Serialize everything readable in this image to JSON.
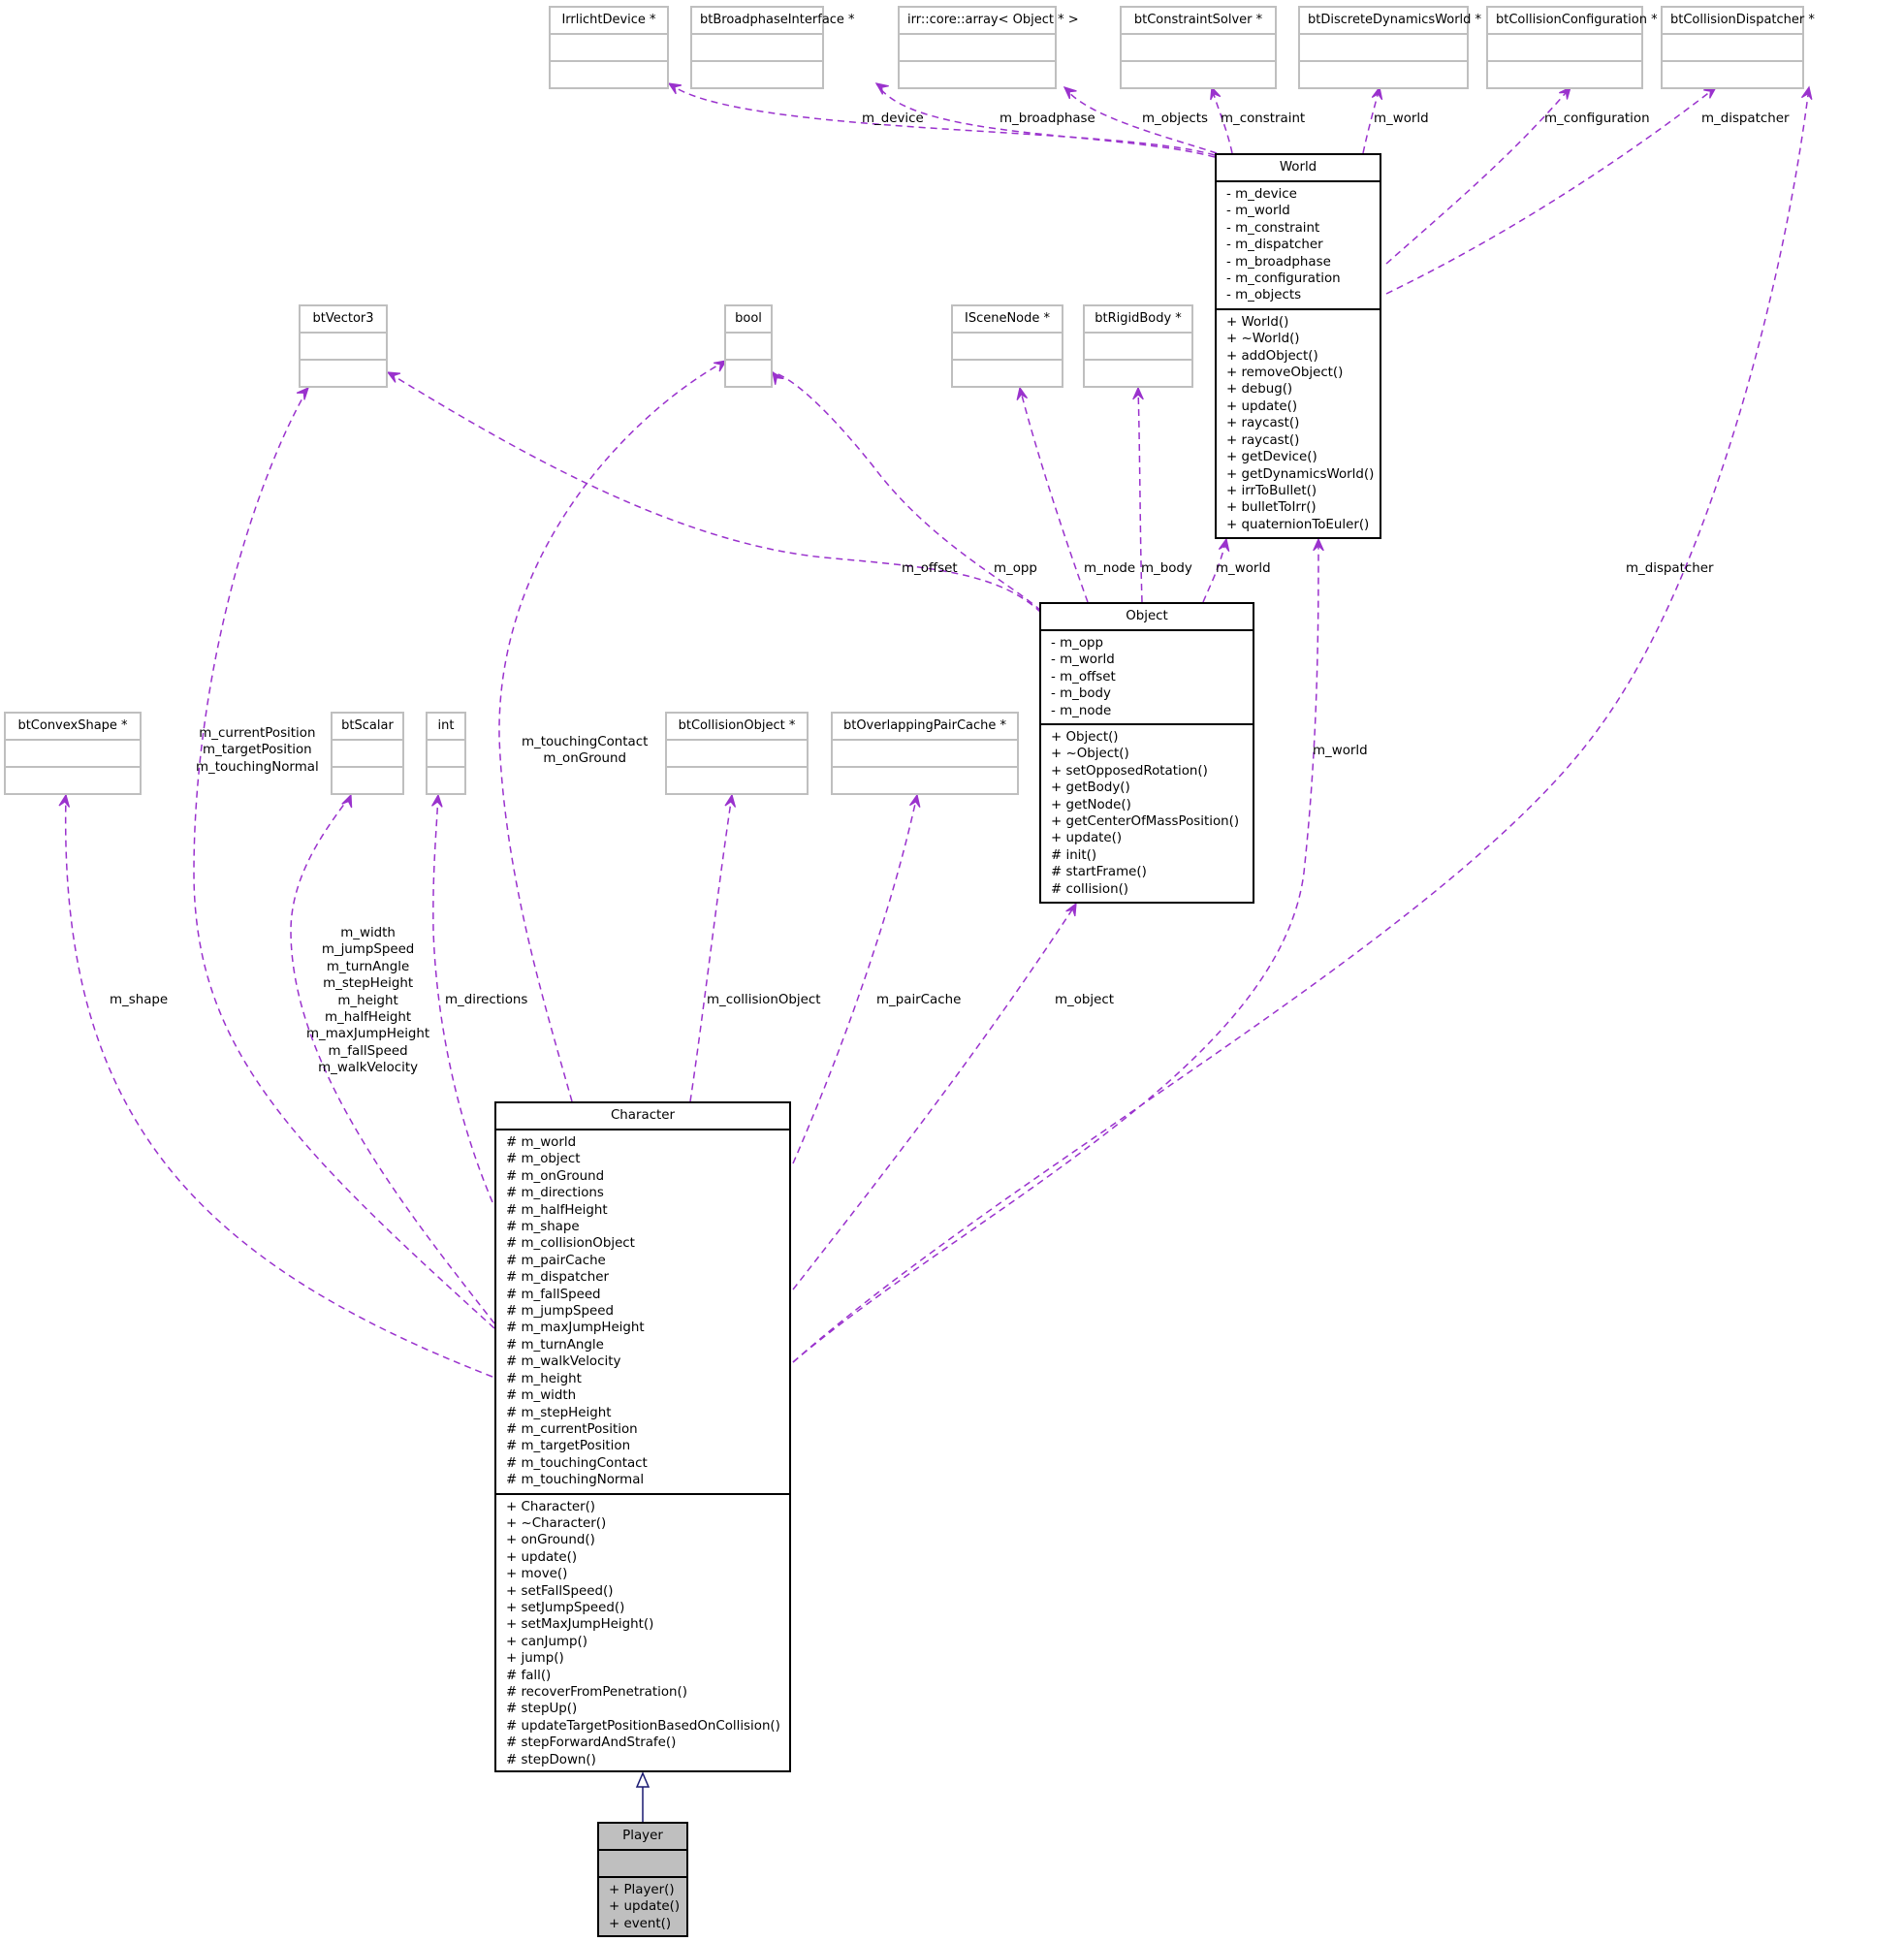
{
  "diagram": {
    "type": "uml-collaboration-diagram",
    "edge_color": "#9a32cd",
    "inheritance_color": "#191970",
    "highlight_fill": "#bfbfbf",
    "classes": {
      "player": {
        "name": "Player",
        "attributes": [],
        "operations": [
          "+ Player()",
          "+ update()",
          "+ event()"
        ]
      },
      "character": {
        "name": "Character",
        "attributes": [
          "# m_world",
          "# m_object",
          "# m_onGround",
          "# m_directions",
          "# m_halfHeight",
          "# m_shape",
          "# m_collisionObject",
          "# m_pairCache",
          "# m_dispatcher",
          "# m_fallSpeed",
          "# m_jumpSpeed",
          "# m_maxJumpHeight",
          "# m_turnAngle",
          "# m_walkVelocity",
          "# m_height",
          "# m_width",
          "# m_stepHeight",
          "# m_currentPosition",
          "# m_targetPosition",
          "# m_touchingContact",
          "# m_touchingNormal"
        ],
        "operations": [
          "+ Character()",
          "+ ~Character()",
          "+ onGround()",
          "+ update()",
          "+ move()",
          "+ setFallSpeed()",
          "+ setJumpSpeed()",
          "+ setMaxJumpHeight()",
          "+ canJump()",
          "+ jump()",
          "# fall()",
          "# recoverFromPenetration()",
          "# stepUp()",
          "# updateTargetPositionBasedOnCollision()",
          "# stepForwardAndStrafe()",
          "# stepDown()"
        ]
      },
      "object": {
        "name": "Object",
        "attributes": [
          "- m_opp",
          "- m_world",
          "- m_offset",
          "- m_body",
          "- m_node"
        ],
        "operations": [
          "+ Object()",
          "+ ~Object()",
          "+ setOpposedRotation()",
          "+ getBody()",
          "+ getNode()",
          "+ getCenterOfMassPosition()",
          "+ update()",
          "# init()",
          "# startFrame()",
          "# collision()"
        ]
      },
      "world": {
        "name": "World",
        "attributes": [
          "- m_device",
          "- m_world",
          "- m_constraint",
          "- m_dispatcher",
          "- m_broadphase",
          "- m_configuration",
          "- m_objects"
        ],
        "operations": [
          "+ World()",
          "+ ~World()",
          "+ addObject()",
          "+ removeObject()",
          "+ debug()",
          "+ update()",
          "+ raycast()",
          "+ raycast()",
          "+ getDevice()",
          "+ getDynamicsWorld()",
          "+ irrToBullet()",
          "+ bulletToIrr()",
          "+ quaternionToEuler()"
        ]
      }
    },
    "external_types": {
      "irrlicht_device": "IrrlichtDevice *",
      "bt_broadphase_interface": "btBroadphaseInterface *",
      "irr_array_object": "irr::core::array< Object * >",
      "bt_constraint_solver": "btConstraintSolver *",
      "bt_discrete_dynamics_world": "btDiscreteDynamicsWorld *",
      "bt_collision_configuration": "btCollisionConfiguration *",
      "bt_collision_dispatcher": "btCollisionDispatcher *",
      "bt_vector3": "btVector3",
      "bool": "bool",
      "iscene_node": "ISceneNode *",
      "bt_rigid_body": "btRigidBody *",
      "bt_convex_shape": "btConvexShape *",
      "bt_scalar": "btScalar",
      "int": "int",
      "bt_collision_object": "btCollisionObject *",
      "bt_overlapping_pair_cache": "btOverlappingPairCache *"
    },
    "edge_labels": {
      "world_device": [
        "m_device"
      ],
      "world_broadphase": [
        "m_broadphase"
      ],
      "world_objects": [
        "m_objects"
      ],
      "world_constraint": [
        "m_constraint"
      ],
      "world_world": [
        "m_world"
      ],
      "world_configuration": [
        "m_configuration"
      ],
      "world_dispatcher": [
        "m_dispatcher"
      ],
      "object_offset": [
        "m_offset"
      ],
      "object_opp": [
        "m_opp"
      ],
      "object_node": [
        "m_node"
      ],
      "object_body": [
        "m_body"
      ],
      "object_world": [
        "m_world"
      ],
      "character_vector3": [
        "m_currentPosition",
        "m_targetPosition",
        "m_touchingNormal"
      ],
      "character_bool": [
        "m_touchingContact",
        "m_onGround"
      ],
      "character_shape": [
        "m_shape"
      ],
      "character_scalar": [
        "m_width",
        "m_jumpSpeed",
        "m_turnAngle",
        "m_stepHeight",
        "m_height",
        "m_halfHeight",
        "m_maxJumpHeight",
        "m_fallSpeed",
        "m_walkVelocity"
      ],
      "character_directions": [
        "m_directions"
      ],
      "character_collision_object": [
        "m_collisionObject"
      ],
      "character_pair_cache": [
        "m_pairCache"
      ],
      "character_object": [
        "m_object"
      ],
      "character_world": [
        "m_world"
      ],
      "character_dispatcher": [
        "m_dispatcher"
      ]
    }
  }
}
